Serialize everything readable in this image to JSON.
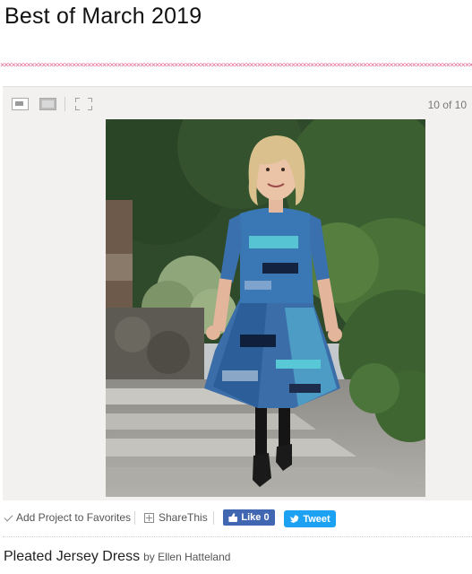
{
  "page": {
    "title": "Best of March 2019",
    "border_pattern": "××××××××××××××××××××××××××××××××××××××××××××××××××××××××××××××××××××××××××××××××××××××××××××××××××××××××××××××××××××××××××××××××××"
  },
  "viewer": {
    "counter": "10 of 10",
    "buttons": [
      "small-view-icon",
      "large-view-icon",
      "fullscreen-icon"
    ],
    "photo": {
      "icon": "photo-woman-in-blue-dress"
    }
  },
  "actions": {
    "favorites_label": "Add Project to Favorites",
    "share_label": "ShareThis",
    "like_label": "Like 0",
    "tweet_label": "Tweet"
  },
  "project": {
    "title": "Pleated Jersey Dress",
    "byline": "by Ellen Hatteland"
  },
  "colors": {
    "accent_pink": "#e86a9a",
    "facebook": "#4267b2",
    "twitter": "#1da1f2"
  }
}
